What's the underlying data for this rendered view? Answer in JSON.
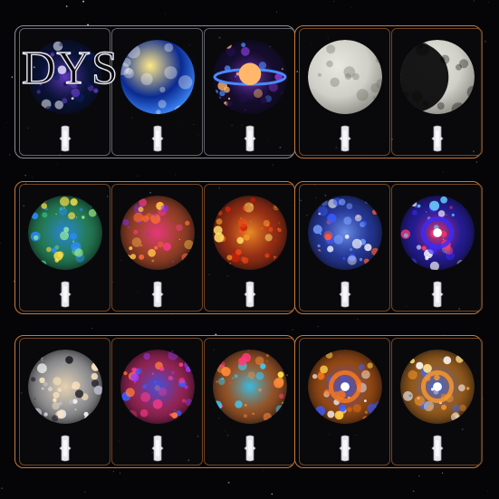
{
  "brand": {
    "logo_text": "DYS"
  },
  "rows": [
    {
      "row": "top",
      "groups": [
        {
          "frame": "silver",
          "slides": [
            {
              "name": "nebula-starfield-slide",
              "palette": [
                "#0a1a55",
                "#6a3fd0",
                "#f0f0ff",
                "#1a0a40"
              ]
            },
            {
              "name": "crescent-moon-clouds-slide",
              "palette": [
                "#0a2a90",
                "#3f8cff",
                "#ffffff",
                "#ffe98a"
              ]
            },
            {
              "name": "ringed-planet-slide",
              "palette": [
                "#20104a",
                "#8a3fe0",
                "#ffb86b",
                "#4a8aff"
              ]
            }
          ]
        },
        {
          "frame": "orange",
          "slides": [
            {
              "name": "full-moon-slide",
              "palette": [
                "#cfcfc8",
                "#8e8e86",
                "#6a6a63",
                "#e8e8e0"
              ]
            },
            {
              "name": "waning-moon-slide",
              "palette": [
                "#cfcfc8",
                "#8e8e86",
                "#0a0a0a",
                "#e8e8e0"
              ]
            }
          ]
        }
      ]
    },
    {
      "row": "middle",
      "groups": [
        {
          "frame": "orange",
          "slides": [
            {
              "name": "green-aurora-nebula-slide",
              "palette": [
                "#39d08a",
                "#2a8cff",
                "#a6ff8a",
                "#ffe14a"
              ]
            },
            {
              "name": "red-star-cluster-slide",
              "palette": [
                "#ff6a3a",
                "#ff3a8a",
                "#ffc24a",
                "#8a2aff"
              ]
            },
            {
              "name": "butterfly-nebula-slide",
              "palette": [
                "#ff4a1a",
                "#ff9a2a",
                "#ffe06a",
                "#c8200a"
              ]
            }
          ]
        },
        {
          "frame": "orange",
          "slides": [
            {
              "name": "blue-dust-cloud-slide",
              "palette": [
                "#3a5aff",
                "#7aa0ff",
                "#ff5a3a",
                "#ffffff"
              ]
            },
            {
              "name": "helix-eye-nebula-slide",
              "palette": [
                "#3a2aff",
                "#ff3a6a",
                "#6ad0ff",
                "#ffffff"
              ]
            }
          ]
        }
      ]
    },
    {
      "row": "bottom",
      "groups": [
        {
          "frame": "orange",
          "slides": [
            {
              "name": "milky-way-streak-slide",
              "palette": [
                "#ffffff",
                "#ffe6c0",
                "#c0c0d0",
                "#1a1a22"
              ]
            },
            {
              "name": "pink-blue-nebula-slide",
              "palette": [
                "#ff3a8a",
                "#3a5aff",
                "#ff7a3a",
                "#a03aff"
              ]
            },
            {
              "name": "colorful-fragments-slide",
              "palette": [
                "#ff8a3a",
                "#3ad0ff",
                "#ff3a7a",
                "#ffe04a"
              ]
            }
          ]
        },
        {
          "frame": "orange",
          "slides": [
            {
              "name": "cartwheel-galaxy-slide",
              "palette": [
                "#ff7a1a",
                "#3a5aff",
                "#ffd04a",
                "#ffffff"
              ]
            },
            {
              "name": "spiral-galaxy-slide",
              "palette": [
                "#ff9a2a",
                "#3a6aff",
                "#ffe08a",
                "#ffffff"
              ]
            }
          ]
        }
      ]
    }
  ]
}
